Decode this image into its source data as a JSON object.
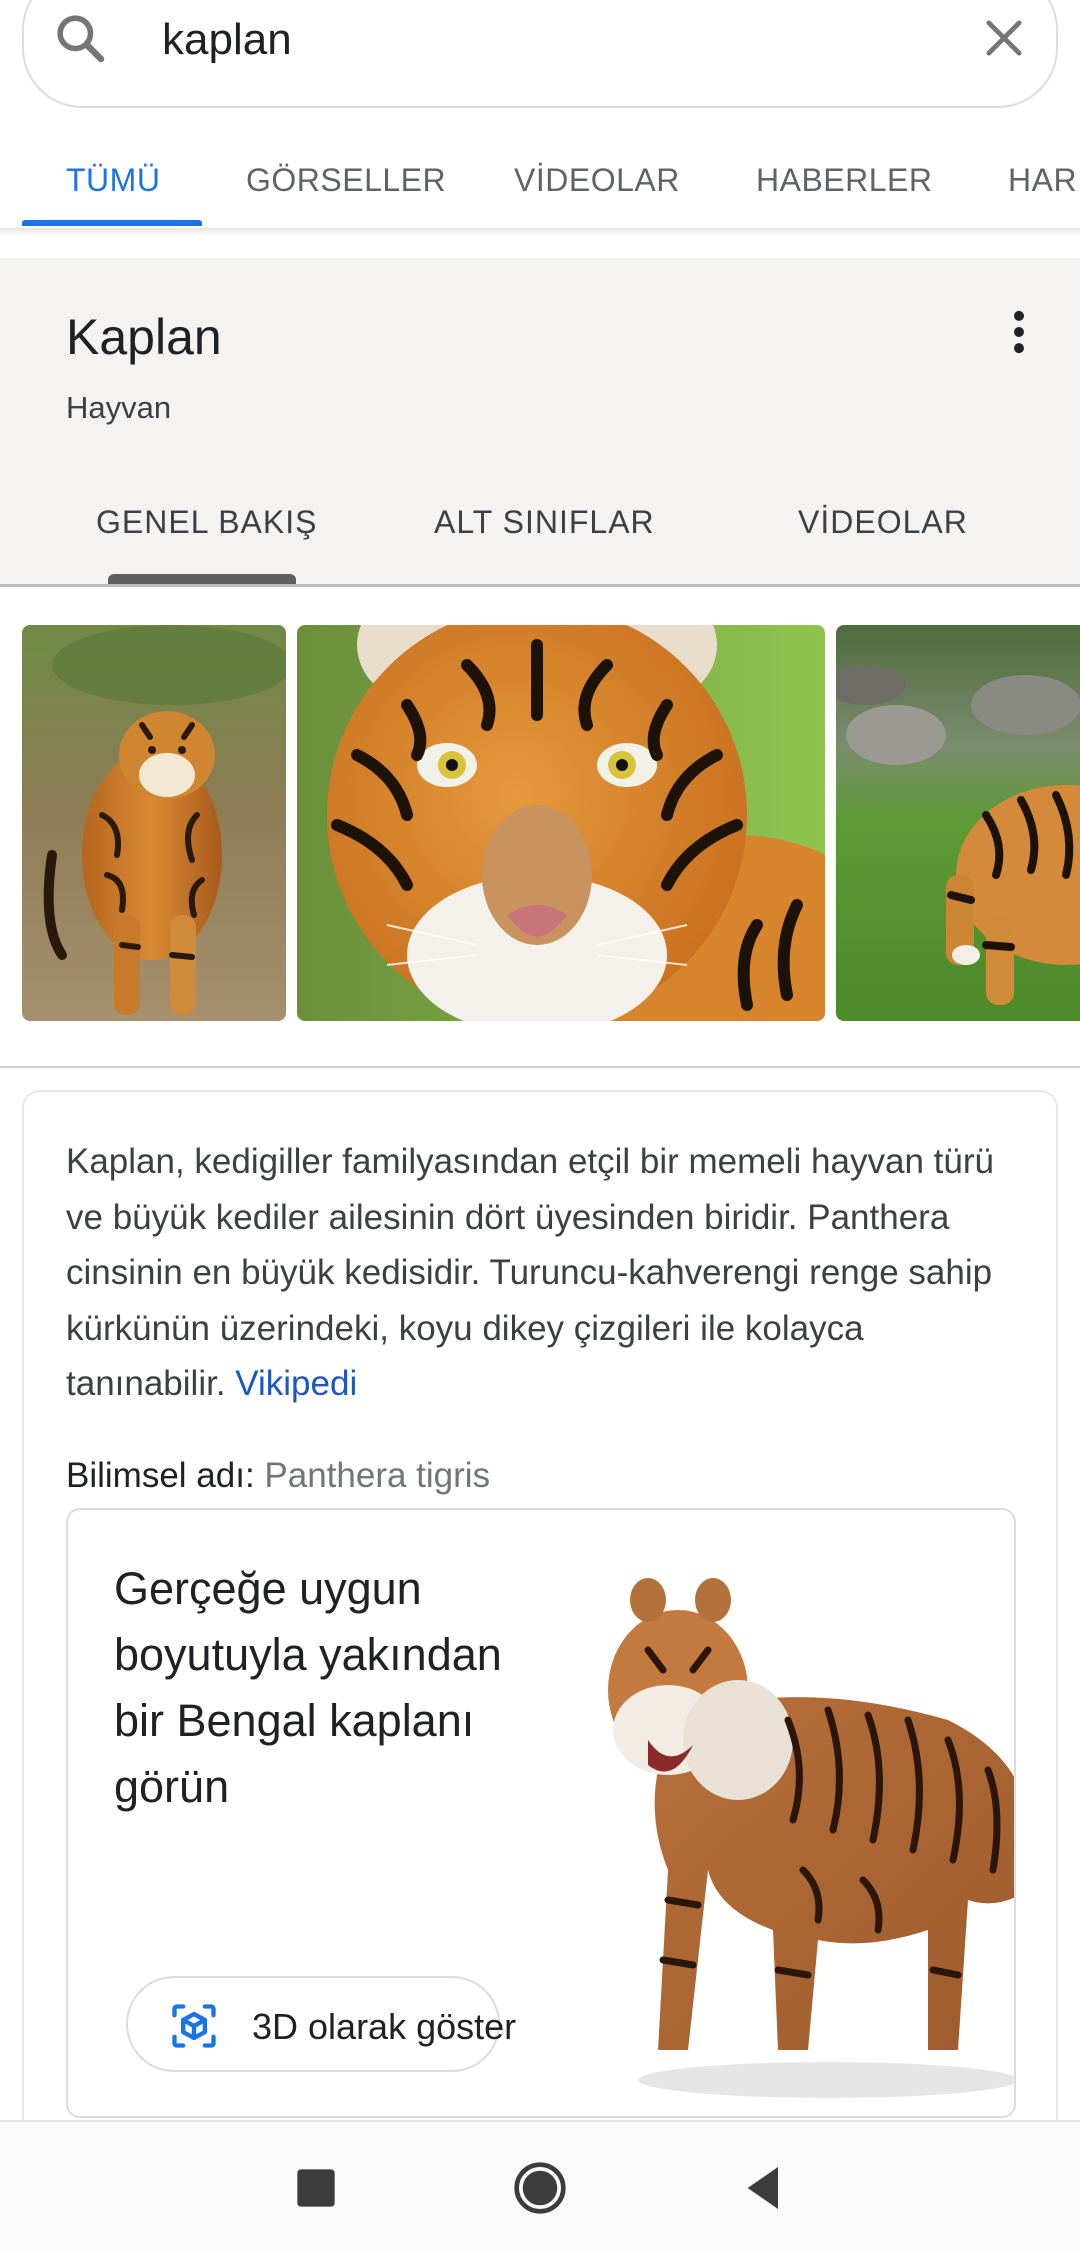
{
  "search": {
    "query": "kaplan",
    "search_icon": "search-icon",
    "clear_icon": "close-icon"
  },
  "main_tabs": [
    {
      "label": "TÜMÜ",
      "active": true
    },
    {
      "label": "GÖRSELLER"
    },
    {
      "label": "VİDEOLAR"
    },
    {
      "label": "HABERLER"
    },
    {
      "label": "HARİ"
    }
  ],
  "knowledge_panel": {
    "title": "Kaplan",
    "subtitle": "Hayvan",
    "menu_icon": "more-vert-icon",
    "tabs": [
      {
        "label": "GENEL BAKIŞ",
        "active": true
      },
      {
        "label": "ALT SINIFLAR"
      },
      {
        "label": "VİDEOLAR"
      }
    ]
  },
  "images": [
    "tiger-walking-image",
    "tiger-face-image",
    "tiger-grass-image"
  ],
  "description": {
    "text": "Kaplan, kedigiller familyasından etçil bir memeli hayvan türü ve büyük kediler ailesinin dört üyesinden biridir. Panthera cinsinin en büyük kedisidir. Turuncu-kahverengi renge sahip kürkünün üzerindeki, koyu dikey çizgileri ile kolayca tanınabilir.",
    "source_link": "Vikipedi"
  },
  "scientific_name": {
    "label": "Bilimsel adı:",
    "value": "Panthera tigris"
  },
  "ar_card": {
    "title": "Gerçeğe uygun boyutuyla yakından bir Bengal kaplanı görün",
    "button_label": "3D olarak göster",
    "button_icon": "ar-cube-icon"
  },
  "nav_bar": {
    "recents_icon": "recents-square-icon",
    "home_icon": "home-circle-icon",
    "back_icon": "back-triangle-icon"
  },
  "colors": {
    "accent": "#1a73e8",
    "link": "#1a57c4",
    "panel_bg": "#f4f3f1"
  }
}
